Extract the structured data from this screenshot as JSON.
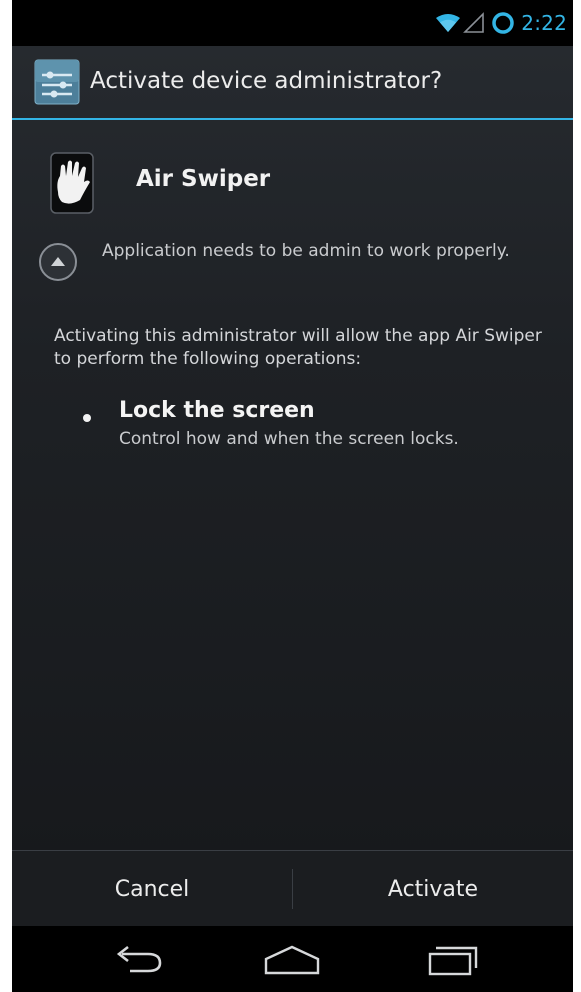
{
  "status_bar": {
    "time": "2:22",
    "icons": [
      "wifi-icon",
      "signal-icon",
      "battery-icon"
    ]
  },
  "dialog": {
    "title": "Activate device administrator?",
    "title_icon": "settings-icon",
    "app_name": "Air Swiper",
    "app_icon": "hand-icon",
    "description": "Application needs to be admin to work properly.",
    "activation_warning": "Activating this administrator will allow the app Air Swiper to perform the following operations:",
    "policies": [
      {
        "title": "Lock the screen",
        "description": "Control how and when the screen locks."
      }
    ],
    "buttons": {
      "cancel": "Cancel",
      "activate": "Activate"
    }
  },
  "nav_bar": {
    "icons": [
      "back-icon",
      "home-icon",
      "recents-icon"
    ]
  },
  "colors": {
    "accent": "#33b5e5",
    "background": "#1e2125",
    "text": "#ececec"
  }
}
